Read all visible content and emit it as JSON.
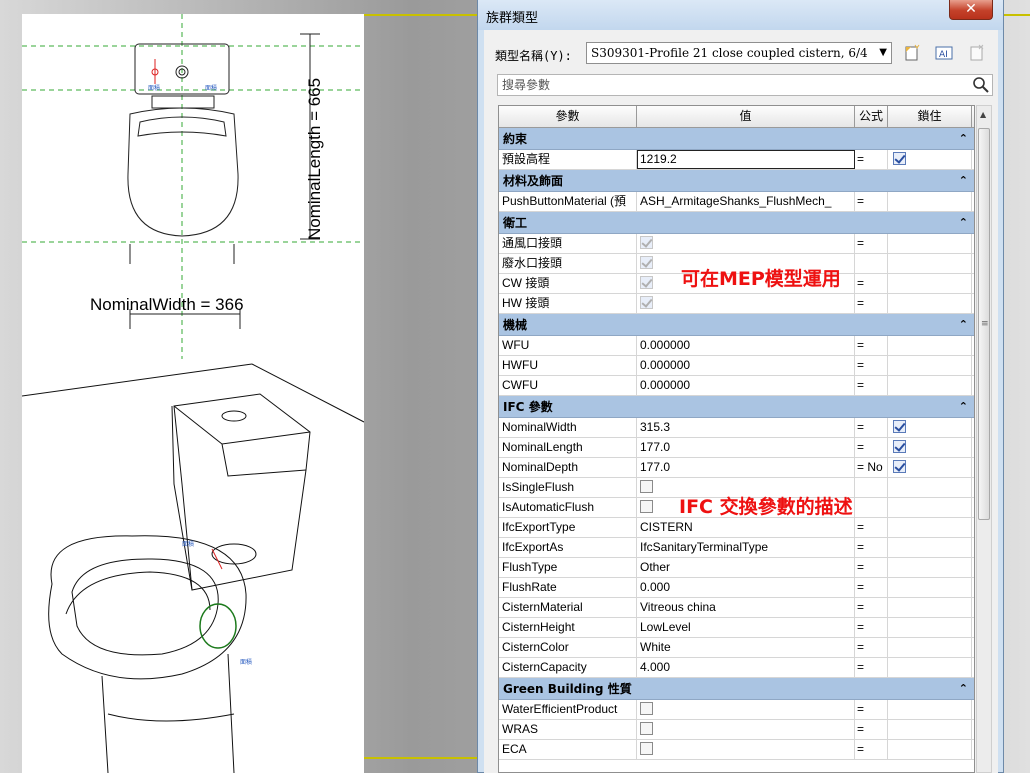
{
  "drawing": {
    "width_label": "NominalWidth = 366",
    "length_label": "NominalLength = 665",
    "small_tags": [
      "面積",
      "面積",
      "面積",
      "面積"
    ]
  },
  "dialog": {
    "title": "族群類型",
    "close": "✕",
    "type_label": "類型名稱(Y):",
    "type_value": "S309301-Profile 21 close coupled cistern, 6/4",
    "search_placeholder": "搜尋參數",
    "columns": [
      "參數",
      "值",
      "公式",
      "鎖住"
    ]
  },
  "groups": [
    {
      "name": "約束",
      "rows": [
        {
          "param": "預設高程",
          "value": "1219.2",
          "formula": "=",
          "lock": true,
          "editing": true
        }
      ]
    },
    {
      "name": "材料及飾面",
      "rows": [
        {
          "param": "PushButtonMaterial (預",
          "value": "ASH_ArmitageShanks_FlushMech_",
          "formula": "=",
          "lock": null
        }
      ]
    },
    {
      "name": "衛工",
      "rows": [
        {
          "param": "通風口接頭",
          "check": "dis-on",
          "formula": "=",
          "lock": null
        },
        {
          "param": "廢水口接頭",
          "check": "dis-on",
          "formula": "",
          "lock": null
        },
        {
          "param": "CW 接頭",
          "check": "dis-on",
          "formula": "=",
          "lock": null
        },
        {
          "param": "HW 接頭",
          "check": "dis-on",
          "formula": "=",
          "lock": null
        }
      ]
    },
    {
      "name": "機械",
      "rows": [
        {
          "param": "WFU",
          "value": "0.000000",
          "formula": "=",
          "lock": null
        },
        {
          "param": "HWFU",
          "value": "0.000000",
          "formula": "=",
          "lock": null
        },
        {
          "param": "CWFU",
          "value": "0.000000",
          "formula": "=",
          "lock": null
        }
      ]
    },
    {
      "name": "IFC 參數",
      "rows": [
        {
          "param": "NominalWidth",
          "value": "315.3",
          "formula": "=",
          "lock": true
        },
        {
          "param": "NominalLength",
          "value": "177.0",
          "formula": "=",
          "lock": true
        },
        {
          "param": "NominalDepth",
          "value": "177.0",
          "formula": "= No",
          "lock": true
        },
        {
          "param": "IsSingleFlush",
          "check": "off",
          "formula": "",
          "lock": null
        },
        {
          "param": "IsAutomaticFlush",
          "check": "off",
          "formula": "",
          "lock": null
        },
        {
          "param": "IfcExportType",
          "value": "CISTERN",
          "formula": "=",
          "lock": null
        },
        {
          "param": "IfcExportAs",
          "value": "IfcSanitaryTerminalType",
          "formula": "=",
          "lock": null
        },
        {
          "param": "FlushType",
          "value": "Other",
          "formula": "=",
          "lock": null
        },
        {
          "param": "FlushRate",
          "value": "0.000",
          "formula": "=",
          "lock": null
        },
        {
          "param": "CisternMaterial",
          "value": "Vitreous china",
          "formula": "=",
          "lock": null
        },
        {
          "param": "CisternHeight",
          "value": "LowLevel",
          "formula": "=",
          "lock": null
        },
        {
          "param": "CisternColor",
          "value": "White",
          "formula": "=",
          "lock": null
        },
        {
          "param": "CisternCapacity",
          "value": "4.000",
          "formula": "=",
          "lock": null
        }
      ]
    },
    {
      "name": "Green Building 性質",
      "rows": [
        {
          "param": "WaterEfficientProduct",
          "check": "off",
          "formula": "=",
          "lock": null
        },
        {
          "param": "WRAS",
          "check": "off",
          "formula": "=",
          "lock": null
        },
        {
          "param": "ECA",
          "check": "off",
          "formula": "=",
          "lock": null
        }
      ]
    }
  ],
  "annotations": {
    "mep": "可在MEP模型運用",
    "ifc": "IFC 交換參數的描述"
  },
  "colors": {
    "accent_red": "#e11111",
    "group_header": "#aac4e2"
  }
}
